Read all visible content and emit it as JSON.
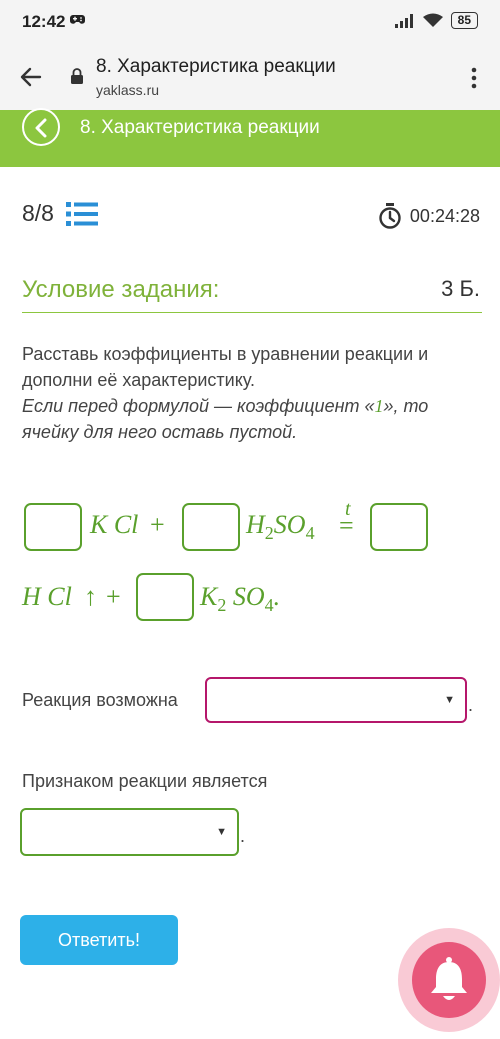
{
  "status_bar": {
    "time": "12:42",
    "battery": "85"
  },
  "browser": {
    "tab_title": "8. Характеристика реакции",
    "url": "yaklass.ru"
  },
  "banner": {
    "title": "8. Характеристика реакции"
  },
  "progress": {
    "counter": "8/8"
  },
  "timer": {
    "value": "00:24:28"
  },
  "task": {
    "label": "Условие задания:",
    "points": "3 Б.",
    "instruction_line1": "Расставь коэффициенты в уравнении реакции и дополни её характеристику.",
    "instruction_line2_a": "Если перед формулой — коэффициент «",
    "instruction_line2_num": "1",
    "instruction_line2_b": "», то ячейку для него оставь пустой."
  },
  "equation": {
    "term1": "K Cl",
    "plus": "+",
    "term2_a": "H",
    "term2_sub1": "2",
    "term2_b": "SO",
    "term2_sub2": "4",
    "condition": "t",
    "equals": "=",
    "term3": "H Cl",
    "arrow": "↑",
    "term4_a": "K",
    "term4_sub1": "2",
    "term4_b": " SO",
    "term4_sub2": "4",
    "period": "."
  },
  "fields": {
    "possible_label": "Реакция возможна",
    "possible_value": "",
    "sign_label": "Признаком реакции является",
    "sign_value": "",
    "dot": "."
  },
  "actions": {
    "answer_label": "Ответить!"
  },
  "colors": {
    "accent_green": "#8cc63f",
    "eq_green": "#5aa02c",
    "button_blue": "#2db0e8",
    "select_magenta": "#b5176b",
    "bell_pink": "#e8577a"
  },
  "icons": [
    "gamepad-icon",
    "signal-icon",
    "wifi-icon",
    "back-arrow-icon",
    "lock-icon",
    "more-vert-icon",
    "chevron-left-icon",
    "list-icon",
    "stopwatch-icon",
    "bell-icon"
  ]
}
